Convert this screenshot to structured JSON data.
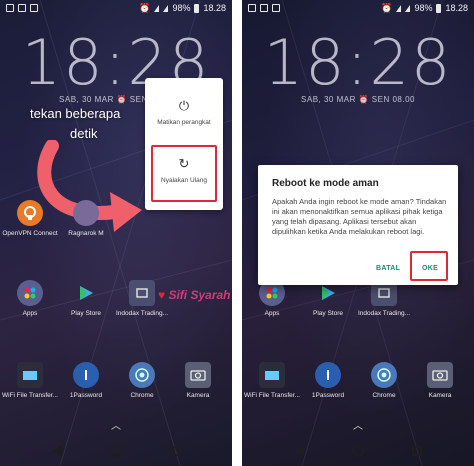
{
  "status_bar": {
    "battery": "98%",
    "time": "18.28"
  },
  "lock_clock": "18:28",
  "date_line": "SAB, 30 MAR   ⏰  SEN 08.00",
  "colors": {
    "accent": "#1b8a6b",
    "highlight": "#e0283a",
    "arrow": "#f0606a"
  },
  "left_screen": {
    "instruction_line1": "tekan beberapa",
    "instruction_line2": "detik",
    "power_menu": {
      "shutdown": {
        "icon": "power-icon",
        "label": "Matikan perangkat"
      },
      "restart": {
        "icon": "restart-icon",
        "label": "Nyalakan Ulang"
      }
    },
    "apps_row1": [
      {
        "label": "OpenVPN Connect",
        "icon": "openvpn-icon"
      },
      {
        "label": "Ragnarok M",
        "icon": "ragnarok-icon"
      }
    ],
    "apps_row2": [
      {
        "label": "Apps",
        "icon": "apps-icon"
      },
      {
        "label": "Play Store",
        "icon": "play-store-icon"
      },
      {
        "label": "Indodax Trading...",
        "icon": "indodax-icon"
      }
    ],
    "apps_row3": [
      {
        "label": "WiFi File Transfer...",
        "icon": "wifi-transfer-icon"
      },
      {
        "label": "1Password",
        "icon": "onepassword-icon"
      },
      {
        "label": "Chrome",
        "icon": "chrome-icon"
      },
      {
        "label": "Kamera",
        "icon": "camera-icon"
      }
    ],
    "watermark": "Sifi Syarah"
  },
  "right_screen": {
    "dialog": {
      "title": "Reboot ke mode aman",
      "body": "Apakah Anda ingin reboot ke mode aman? Tindakan ini akan menonaktifkan semua aplikasi pihak ketiga yang telah dipasang. Aplikasi tersebut akan dipulihkan ketika Anda melakukan reboot lagi.",
      "cancel_label": "BATAL",
      "ok_label": "OKE"
    },
    "apps_row2": [
      {
        "label": "Apps",
        "icon": "apps-icon"
      },
      {
        "label": "Play Store",
        "icon": "play-store-icon"
      },
      {
        "label": "Indodax Trading...",
        "icon": "indodax-icon"
      },
      {
        "label": "",
        "icon": "blank-icon"
      }
    ],
    "apps_row3": [
      {
        "label": "WiFi File Transfer...",
        "icon": "wifi-transfer-icon"
      },
      {
        "label": "1Password",
        "icon": "onepassword-icon"
      },
      {
        "label": "Chrome",
        "icon": "chrome-icon"
      },
      {
        "label": "Kamera",
        "icon": "camera-icon"
      }
    ]
  }
}
